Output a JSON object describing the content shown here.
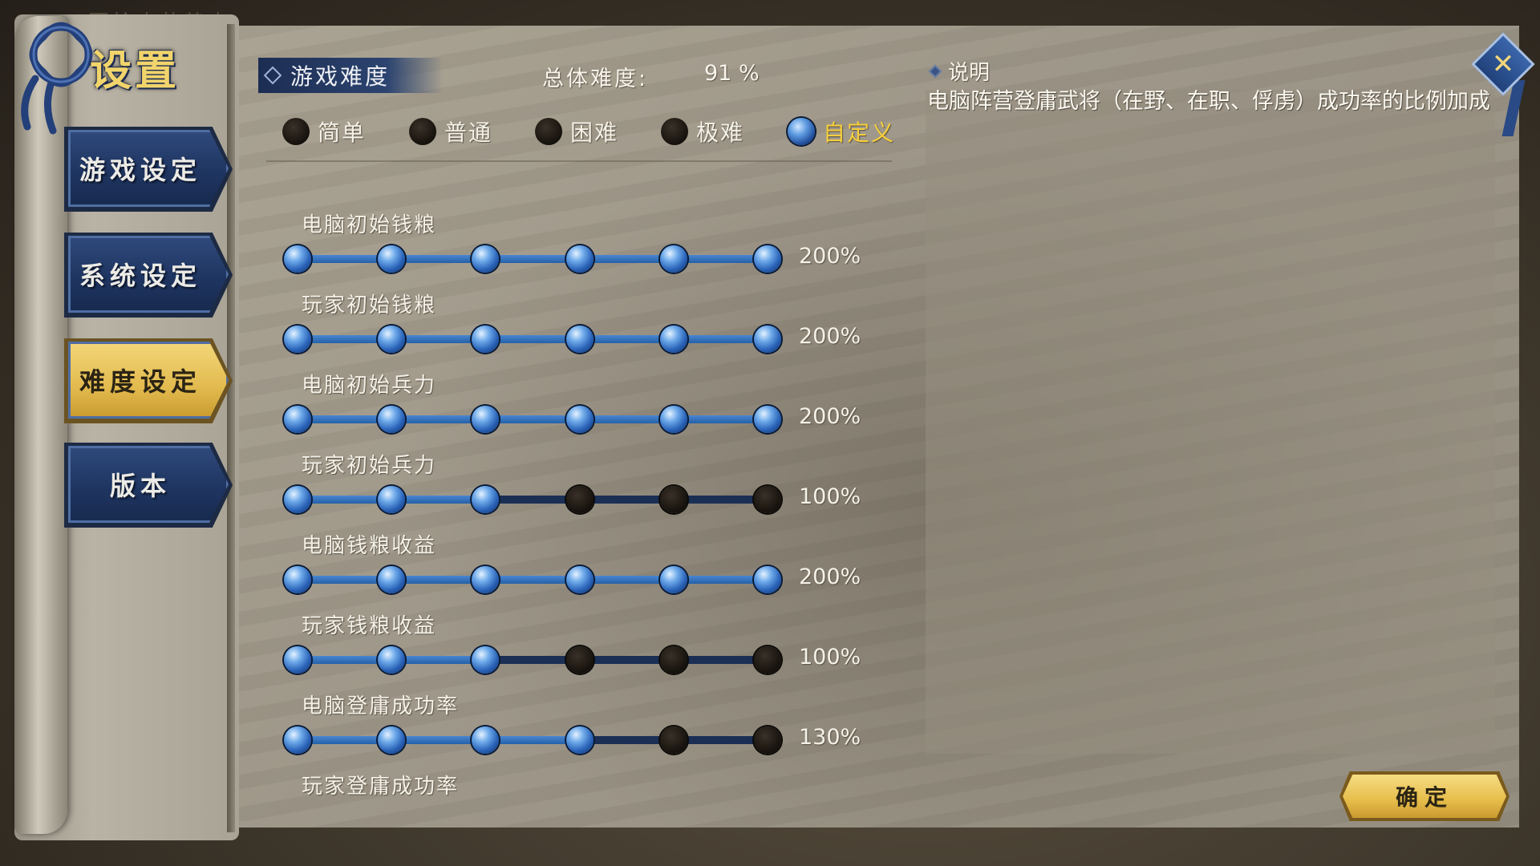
{
  "background": {
    "top_text": "要检查的势力"
  },
  "header": {
    "title": "设置"
  },
  "nav": {
    "items": [
      {
        "label": "游戏设定",
        "active": false
      },
      {
        "label": "系统设定",
        "active": false
      },
      {
        "label": "难度设定",
        "active": true
      },
      {
        "label": "版本",
        "active": false
      }
    ]
  },
  "difficulty": {
    "tab_label": "游戏难度",
    "overall_label": "总体难度:",
    "overall_value": "91 %",
    "presets": [
      {
        "label": "简单",
        "selected": false
      },
      {
        "label": "普通",
        "selected": false
      },
      {
        "label": "困难",
        "selected": false
      },
      {
        "label": "极难",
        "selected": false
      },
      {
        "label": "自定义",
        "selected": true
      }
    ]
  },
  "sliders": [
    {
      "label": "电脑初始钱粮",
      "value": "200%",
      "level": 6,
      "steps": 6
    },
    {
      "label": "玩家初始钱粮",
      "value": "200%",
      "level": 6,
      "steps": 6
    },
    {
      "label": "电脑初始兵力",
      "value": "200%",
      "level": 6,
      "steps": 6
    },
    {
      "label": "玩家初始兵力",
      "value": "100%",
      "level": 3,
      "steps": 6
    },
    {
      "label": "电脑钱粮收益",
      "value": "200%",
      "level": 6,
      "steps": 6
    },
    {
      "label": "玩家钱粮收益",
      "value": "100%",
      "level": 3,
      "steps": 6
    },
    {
      "label": "电脑登庸成功率",
      "value": "130%",
      "level": 4,
      "steps": 6
    },
    {
      "label": "玩家登庸成功率",
      "value": "",
      "level": null,
      "steps": 6
    }
  ],
  "description": {
    "header": "说明",
    "text": "电脑阵营登庸武将（在野、在职、俘虏）成功率的比例加成"
  },
  "buttons": {
    "confirm": "确定"
  },
  "colors": {
    "accent_gold": "#f7cf3c",
    "track_blue": "#2461a8",
    "nav_blue": "#1f3561"
  }
}
